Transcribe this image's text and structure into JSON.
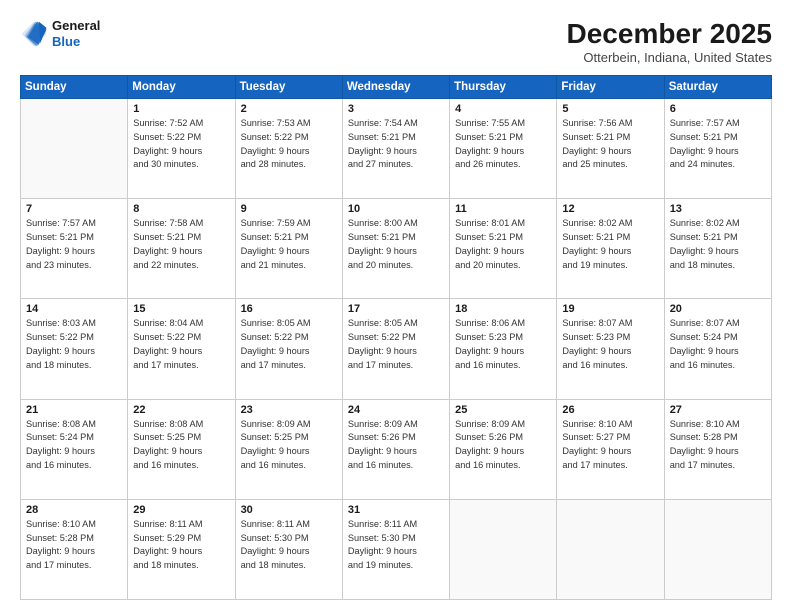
{
  "header": {
    "logo_line1": "General",
    "logo_line2": "Blue",
    "month": "December 2025",
    "location": "Otterbein, Indiana, United States"
  },
  "weekdays": [
    "Sunday",
    "Monday",
    "Tuesday",
    "Wednesday",
    "Thursday",
    "Friday",
    "Saturday"
  ],
  "weeks": [
    [
      {
        "day": "",
        "info": ""
      },
      {
        "day": "1",
        "info": "Sunrise: 7:52 AM\nSunset: 5:22 PM\nDaylight: 9 hours\nand 30 minutes."
      },
      {
        "day": "2",
        "info": "Sunrise: 7:53 AM\nSunset: 5:22 PM\nDaylight: 9 hours\nand 28 minutes."
      },
      {
        "day": "3",
        "info": "Sunrise: 7:54 AM\nSunset: 5:21 PM\nDaylight: 9 hours\nand 27 minutes."
      },
      {
        "day": "4",
        "info": "Sunrise: 7:55 AM\nSunset: 5:21 PM\nDaylight: 9 hours\nand 26 minutes."
      },
      {
        "day": "5",
        "info": "Sunrise: 7:56 AM\nSunset: 5:21 PM\nDaylight: 9 hours\nand 25 minutes."
      },
      {
        "day": "6",
        "info": "Sunrise: 7:57 AM\nSunset: 5:21 PM\nDaylight: 9 hours\nand 24 minutes."
      }
    ],
    [
      {
        "day": "7",
        "info": "Sunrise: 7:57 AM\nSunset: 5:21 PM\nDaylight: 9 hours\nand 23 minutes."
      },
      {
        "day": "8",
        "info": "Sunrise: 7:58 AM\nSunset: 5:21 PM\nDaylight: 9 hours\nand 22 minutes."
      },
      {
        "day": "9",
        "info": "Sunrise: 7:59 AM\nSunset: 5:21 PM\nDaylight: 9 hours\nand 21 minutes."
      },
      {
        "day": "10",
        "info": "Sunrise: 8:00 AM\nSunset: 5:21 PM\nDaylight: 9 hours\nand 20 minutes."
      },
      {
        "day": "11",
        "info": "Sunrise: 8:01 AM\nSunset: 5:21 PM\nDaylight: 9 hours\nand 20 minutes."
      },
      {
        "day": "12",
        "info": "Sunrise: 8:02 AM\nSunset: 5:21 PM\nDaylight: 9 hours\nand 19 minutes."
      },
      {
        "day": "13",
        "info": "Sunrise: 8:02 AM\nSunset: 5:21 PM\nDaylight: 9 hours\nand 18 minutes."
      }
    ],
    [
      {
        "day": "14",
        "info": "Sunrise: 8:03 AM\nSunset: 5:22 PM\nDaylight: 9 hours\nand 18 minutes."
      },
      {
        "day": "15",
        "info": "Sunrise: 8:04 AM\nSunset: 5:22 PM\nDaylight: 9 hours\nand 17 minutes."
      },
      {
        "day": "16",
        "info": "Sunrise: 8:05 AM\nSunset: 5:22 PM\nDaylight: 9 hours\nand 17 minutes."
      },
      {
        "day": "17",
        "info": "Sunrise: 8:05 AM\nSunset: 5:22 PM\nDaylight: 9 hours\nand 17 minutes."
      },
      {
        "day": "18",
        "info": "Sunrise: 8:06 AM\nSunset: 5:23 PM\nDaylight: 9 hours\nand 16 minutes."
      },
      {
        "day": "19",
        "info": "Sunrise: 8:07 AM\nSunset: 5:23 PM\nDaylight: 9 hours\nand 16 minutes."
      },
      {
        "day": "20",
        "info": "Sunrise: 8:07 AM\nSunset: 5:24 PM\nDaylight: 9 hours\nand 16 minutes."
      }
    ],
    [
      {
        "day": "21",
        "info": "Sunrise: 8:08 AM\nSunset: 5:24 PM\nDaylight: 9 hours\nand 16 minutes."
      },
      {
        "day": "22",
        "info": "Sunrise: 8:08 AM\nSunset: 5:25 PM\nDaylight: 9 hours\nand 16 minutes."
      },
      {
        "day": "23",
        "info": "Sunrise: 8:09 AM\nSunset: 5:25 PM\nDaylight: 9 hours\nand 16 minutes."
      },
      {
        "day": "24",
        "info": "Sunrise: 8:09 AM\nSunset: 5:26 PM\nDaylight: 9 hours\nand 16 minutes."
      },
      {
        "day": "25",
        "info": "Sunrise: 8:09 AM\nSunset: 5:26 PM\nDaylight: 9 hours\nand 16 minutes."
      },
      {
        "day": "26",
        "info": "Sunrise: 8:10 AM\nSunset: 5:27 PM\nDaylight: 9 hours\nand 17 minutes."
      },
      {
        "day": "27",
        "info": "Sunrise: 8:10 AM\nSunset: 5:28 PM\nDaylight: 9 hours\nand 17 minutes."
      }
    ],
    [
      {
        "day": "28",
        "info": "Sunrise: 8:10 AM\nSunset: 5:28 PM\nDaylight: 9 hours\nand 17 minutes."
      },
      {
        "day": "29",
        "info": "Sunrise: 8:11 AM\nSunset: 5:29 PM\nDaylight: 9 hours\nand 18 minutes."
      },
      {
        "day": "30",
        "info": "Sunrise: 8:11 AM\nSunset: 5:30 PM\nDaylight: 9 hours\nand 18 minutes."
      },
      {
        "day": "31",
        "info": "Sunrise: 8:11 AM\nSunset: 5:30 PM\nDaylight: 9 hours\nand 19 minutes."
      },
      {
        "day": "",
        "info": ""
      },
      {
        "day": "",
        "info": ""
      },
      {
        "day": "",
        "info": ""
      }
    ]
  ]
}
